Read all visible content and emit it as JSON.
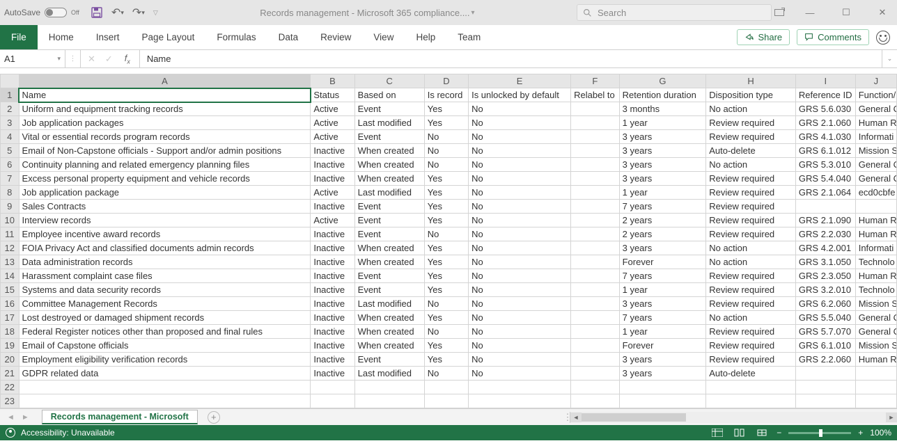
{
  "titlebar": {
    "autosave_label": "AutoSave",
    "autosave_state": "Off",
    "doc_title": "Records management - Microsoft 365 compliance....",
    "search_placeholder": "Search"
  },
  "ribbon": {
    "tabs": [
      "File",
      "Home",
      "Insert",
      "Page Layout",
      "Formulas",
      "Data",
      "Review",
      "View",
      "Help",
      "Team"
    ],
    "share": "Share",
    "comments": "Comments"
  },
  "fxbar": {
    "namebox": "A1",
    "formula": "Name"
  },
  "columns": [
    "A",
    "B",
    "C",
    "D",
    "E",
    "F",
    "G",
    "H",
    "I",
    "J"
  ],
  "headers": [
    "Name",
    "Status",
    "Based on",
    "Is record",
    "Is unlocked by default",
    "Relabel to",
    "Retention duration",
    "Disposition type",
    "Reference ID",
    "Function/"
  ],
  "rows": [
    [
      "Uniform and equipment tracking records",
      "Active",
      "Event",
      "Yes",
      "No",
      "",
      "3 months",
      "No action",
      "GRS 5.6.030",
      "General O"
    ],
    [
      "Job application packages",
      "Active",
      "Last modified",
      "Yes",
      "No",
      "",
      "1 year",
      "Review required",
      "GRS 2.1.060",
      "Human R"
    ],
    [
      "Vital or essential records program records",
      "Active",
      "Event",
      "No",
      "No",
      "",
      "3 years",
      "Review required",
      "GRS 4.1.030",
      "Informati"
    ],
    [
      "Email of Non-Capstone officials - Support and/or admin positions",
      "Inactive",
      "When created",
      "No",
      "No",
      "",
      "3 years",
      "Auto-delete",
      "GRS 6.1.012",
      "Mission S"
    ],
    [
      "Continuity planning and related emergency planning files",
      "Inactive",
      "When created",
      "No",
      "No",
      "",
      "3 years",
      "No action",
      "GRS 5.3.010",
      "General O"
    ],
    [
      "Excess personal property equipment and vehicle records",
      "Inactive",
      "When created",
      "Yes",
      "No",
      "",
      "3 years",
      "Review required",
      "GRS 5.4.040",
      "General O"
    ],
    [
      "Job application package",
      "Active",
      "Last modified",
      "Yes",
      "No",
      "",
      "1 year",
      "Review required",
      "GRS 2.1.064",
      "ecd0cbfe"
    ],
    [
      "Sales Contracts",
      "Inactive",
      "Event",
      "Yes",
      "No",
      "",
      "7 years",
      "Review required",
      "",
      ""
    ],
    [
      "Interview records",
      "Active",
      "Event",
      "Yes",
      "No",
      "",
      "2 years",
      "Review required",
      "GRS 2.1.090",
      "Human R"
    ],
    [
      "Employee incentive award records",
      "Inactive",
      "Event",
      "No",
      "No",
      "",
      "2 years",
      "Review required",
      "GRS 2.2.030",
      "Human R"
    ],
    [
      "FOIA Privacy Act and classified documents admin records",
      "Inactive",
      "When created",
      "Yes",
      "No",
      "",
      "3 years",
      "No action",
      "GRS 4.2.001",
      "Informati"
    ],
    [
      "Data administration records",
      "Inactive",
      "When created",
      "Yes",
      "No",
      "",
      "Forever",
      "No action",
      "GRS 3.1.050",
      "Technolo"
    ],
    [
      "Harassment complaint case files",
      "Inactive",
      "Event",
      "Yes",
      "No",
      "",
      "7 years",
      "Review required",
      "GRS 2.3.050",
      "Human R"
    ],
    [
      "Systems and data security records",
      "Inactive",
      "Event",
      "Yes",
      "No",
      "",
      "1 year",
      "Review required",
      "GRS 3.2.010",
      "Technolo"
    ],
    [
      "Committee Management Records",
      "Inactive",
      "Last modified",
      "No",
      "No",
      "",
      "3 years",
      "Review required",
      "GRS 6.2.060",
      "Mission S"
    ],
    [
      "Lost destroyed or damaged shipment records",
      "Inactive",
      "When created",
      "Yes",
      "No",
      "",
      "7 years",
      "No action",
      "GRS 5.5.040",
      "General O"
    ],
    [
      "Federal Register notices other than proposed and final rules",
      "Inactive",
      "When created",
      "No",
      "No",
      "",
      "1 year",
      "Review required",
      "GRS 5.7.070",
      "General O"
    ],
    [
      "Email of Capstone officials",
      "Inactive",
      "When created",
      "Yes",
      "No",
      "",
      "Forever",
      "Review required",
      "GRS 6.1.010",
      "Mission S"
    ],
    [
      "Employment eligibility verification records",
      "Inactive",
      "Event",
      "Yes",
      "No",
      "",
      "3 years",
      "Review required",
      "GRS 2.2.060",
      "Human R"
    ],
    [
      "GDPR related data",
      "Inactive",
      "Last modified",
      "No",
      "No",
      "",
      "3 years",
      "Auto-delete",
      "",
      ""
    ]
  ],
  "blank_rows": [
    22,
    23
  ],
  "sheet": {
    "active_tab": "Records management - Microsoft"
  },
  "statusbar": {
    "accessibility": "Accessibility: Unavailable",
    "zoom": "100%"
  }
}
